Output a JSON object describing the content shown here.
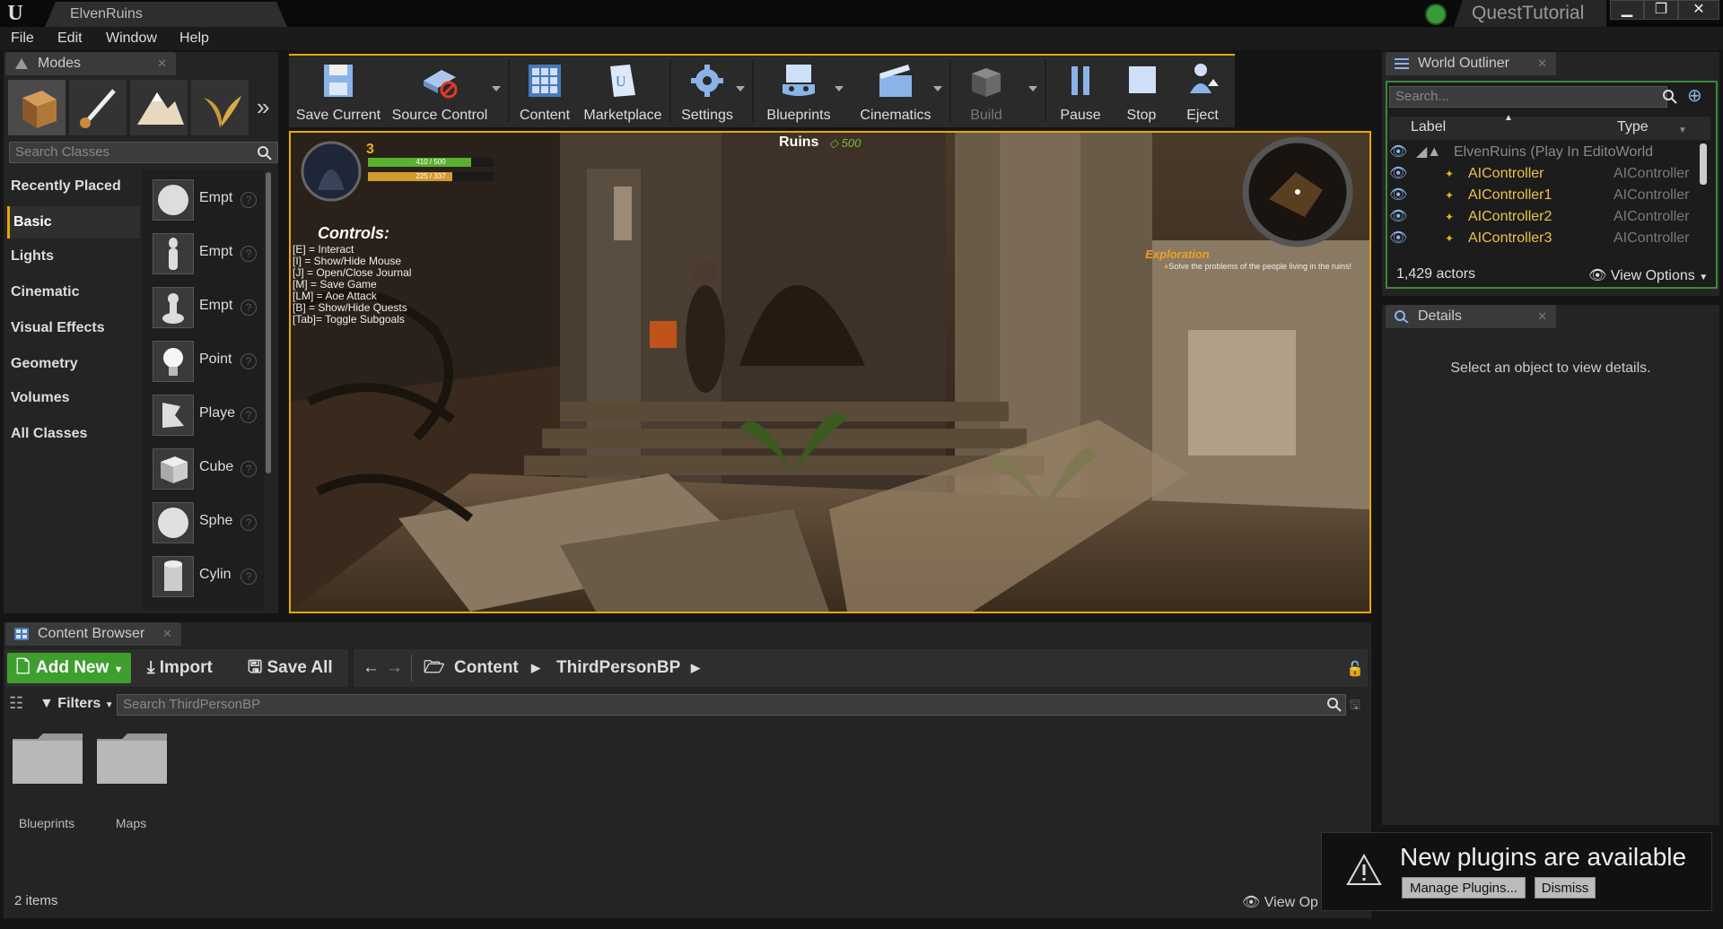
{
  "title_bar": {
    "doc_tab": "ElvenRuins",
    "project_name": "QuestTutorial",
    "minimize": "▁",
    "restore": "❐",
    "close": "✕"
  },
  "menu": [
    "File",
    "Edit",
    "Window",
    "Help"
  ],
  "modes": {
    "tab_label": "Modes",
    "search_placeholder": "Search Classes",
    "categories": [
      "Recently Placed",
      "Basic",
      "Lights",
      "Cinematic",
      "Visual Effects",
      "Geometry",
      "Volumes",
      "All Classes"
    ],
    "selected_category": "Basic",
    "classes": [
      "Empt",
      "Empt",
      "Empt",
      "Point",
      "Playe",
      "Cube",
      "Sphe",
      "Cylin"
    ],
    "help": "?"
  },
  "toolbar": {
    "buttons": [
      {
        "label": "Save Current",
        "icon": "save-icon"
      },
      {
        "label": "Source Control",
        "icon": "source-control-icon"
      },
      {
        "label": "Content",
        "icon": "content-icon"
      },
      {
        "label": "Marketplace",
        "icon": "marketplace-icon"
      },
      {
        "label": "Settings",
        "icon": "settings-icon"
      },
      {
        "label": "Blueprints",
        "icon": "blueprints-icon"
      },
      {
        "label": "Cinematics",
        "icon": "cinematics-icon"
      },
      {
        "label": "Build",
        "icon": "build-icon"
      },
      {
        "label": "Pause",
        "icon": "pause-icon"
      },
      {
        "label": "Stop",
        "icon": "stop-icon"
      },
      {
        "label": "Eject",
        "icon": "eject-icon"
      }
    ]
  },
  "viewport": {
    "level": "3",
    "health": "410 / 500",
    "mana": "225 / 337",
    "health_fraction": 0.82,
    "mana_fraction": 0.67,
    "zone": "Ruins",
    "currency": "500",
    "controls_title": "Controls:",
    "controls": [
      "[E]   = Interact",
      "[I]    = Show/Hide Mouse",
      "[J]    = Open/Close Journal",
      "[M]   = Save Game",
      "[LM] = Aoe Attack",
      "[B]   = Show/Hide Quests",
      "[Tab]= Toggle Subgoals"
    ],
    "quest_title": "Exploration",
    "quest_text": "Solve the problems of the people living in the ruins!"
  },
  "outliner": {
    "tab_label": "World Outliner",
    "search_placeholder": "Search...",
    "col_label": "Label",
    "col_type": "Type",
    "world_row": "ElvenRuins (Play In EditoWorld",
    "rows": [
      {
        "label": "AIController",
        "type": "AIController"
      },
      {
        "label": "AIController1",
        "type": "AIController"
      },
      {
        "label": "AIController2",
        "type": "AIController"
      },
      {
        "label": "AIController3",
        "type": "AIController"
      }
    ],
    "actor_count": "1,429 actors",
    "view_options": "View Options"
  },
  "details": {
    "tab_label": "Details",
    "empty_text": "Select an object to view details."
  },
  "content_browser": {
    "tab_label": "Content Browser",
    "add_new": "Add New",
    "import": "Import",
    "save_all": "Save All",
    "path": [
      "Content",
      "ThirdPersonBP"
    ],
    "filters": "Filters",
    "search_placeholder": "Search ThirdPersonBP",
    "folders": [
      "Blueprints",
      "Maps"
    ],
    "item_count": "2 items",
    "view_options": "View Op"
  },
  "notification": {
    "title": "New plugins are available",
    "manage": "Manage Plugins...",
    "dismiss": "Dismiss"
  },
  "colors": {
    "accent": "#e8a700",
    "green": "#3aa83a",
    "outliner_item": "#e8c34a"
  }
}
